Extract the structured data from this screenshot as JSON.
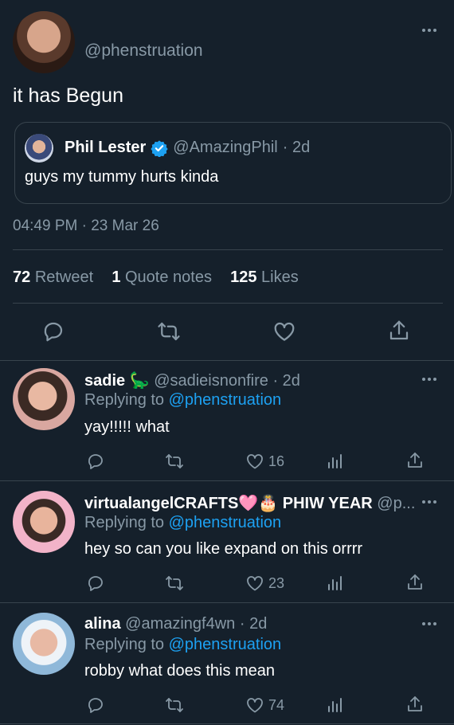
{
  "main_tweet": {
    "handle": "@phenstruation",
    "text": "it has Begun",
    "timestamp": "04:49 PM · 23 Mar 26",
    "quote": {
      "name": "Phil Lester",
      "handle": "@AmazingPhil",
      "age": "· 2d",
      "text": "guys my tummy hurts kinda"
    },
    "stats": {
      "retweets_count": "72",
      "retweets_label": "Retweet",
      "quotes_count": "1",
      "quotes_label": "Quote notes",
      "likes_count": "125",
      "likes_label": "Likes"
    }
  },
  "replies": [
    {
      "name": "sadie",
      "emoji": "🦕",
      "handle": "@sadieisnonfire",
      "age": "· 2d",
      "replying_prefix": "Replying to",
      "replying_handle": "@phenstruation",
      "text": "yay!!!!! what",
      "likes": "16"
    },
    {
      "name": "virtualangelCRAFTS",
      "emoji": "🩷🎂",
      "name_suffix": "PHIW YEAR",
      "handle": "@p...",
      "replying_prefix": "Replying to",
      "replying_handle": "@phenstruation",
      "text": "hey so can you like expand on this orrrr",
      "likes": "23"
    },
    {
      "name": "alina",
      "handle": "@amazingf4wn",
      "age": "· 2d",
      "replying_prefix": "Replying to",
      "replying_handle": "@phenstruation",
      "text": "robby what does this mean",
      "likes": "74"
    }
  ],
  "icons": {
    "reply": "speech-bubble-icon",
    "retweet": "retweet-arrows-icon",
    "like": "heart-icon",
    "share": "share-upload-icon",
    "analytics": "bar-chart-icon",
    "more": "ellipsis-icon",
    "verified": "verified-badge-icon"
  },
  "colors": {
    "background": "#15202b",
    "muted": "#8899a6",
    "link": "#1da1f2",
    "border": "#38444d"
  }
}
